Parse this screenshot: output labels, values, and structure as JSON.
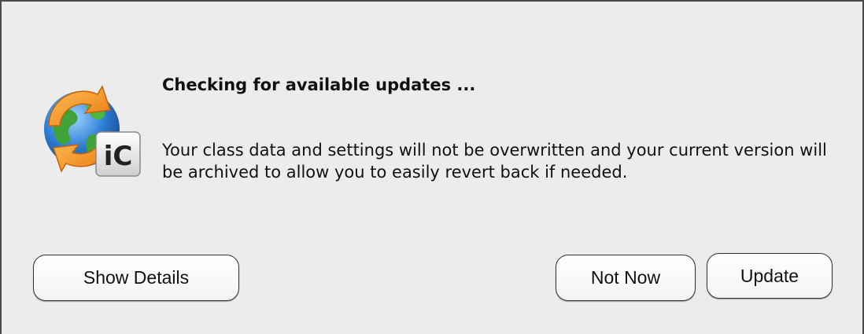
{
  "dialog": {
    "heading": "Checking for available updates ...",
    "message": "Your class data and settings will not be overwritten and your current version will be archived to allow you to easily revert back if needed.",
    "icon": "globe-update-app-icon",
    "icon_badge_text": "iC"
  },
  "buttons": {
    "show_details": "Show Details",
    "not_now": "Not Now",
    "update": "Update"
  }
}
